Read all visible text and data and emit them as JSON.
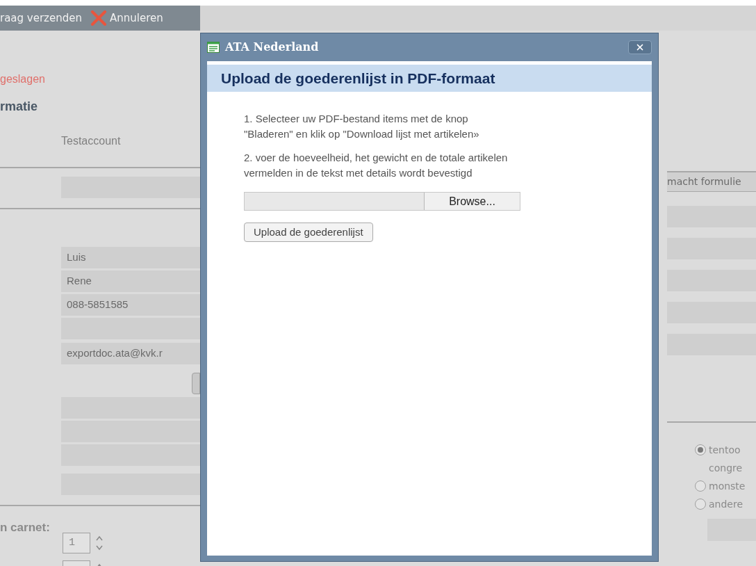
{
  "toolbar": {
    "buttons": [
      {
        "label": "raag verzenden",
        "kind": "send"
      },
      {
        "label": "Annuleren",
        "kind": "cancel"
      }
    ]
  },
  "form": {
    "status": "geslagen",
    "section_title": "rmatie",
    "account": "Testaccount",
    "contact_fields": [
      {
        "value": "Luis"
      },
      {
        "value": "Rene"
      },
      {
        "value": "088-5851585"
      }
    ],
    "email": "exportdoc.ata@kvk.r",
    "carnet_label": "n carnet:",
    "spinners": [
      {
        "value": "1"
      }
    ],
    "side_button": "macht formulie",
    "radios": [
      {
        "lines": [
          "tentoo",
          "congre"
        ],
        "selected": true
      },
      {
        "lines": [
          "monste"
        ],
        "selected": false
      },
      {
        "lines": [
          "andere"
        ],
        "selected": false
      }
    ]
  },
  "dialog": {
    "title": "ATA Nederland",
    "heading": "Upload de goederenlijst in PDF-formaat",
    "steps": [
      {
        "lines": [
          "1. Selecteer uw PDF-bestand items met de knop",
          "\"Bladeren\" en klik op \"Download lijst met artikelen»"
        ]
      },
      {
        "lines": [
          "2. voer de hoeveelheid, het gewicht en de totale artikelen",
          "vermelden in de tekst met details wordt bevestigd"
        ]
      }
    ],
    "browse_button": "Browse...",
    "upload_button": "Upload de goederenlijst"
  }
}
